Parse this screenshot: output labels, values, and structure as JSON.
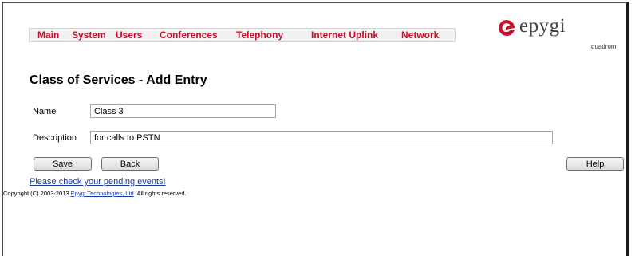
{
  "nav": {
    "items": [
      "Main",
      "System",
      "Users",
      "Conferences",
      "Telephony",
      "Internet Uplink",
      "Network"
    ]
  },
  "brand": {
    "name": "epygi",
    "subtitle": "quadrom",
    "color": "#c8102e"
  },
  "page": {
    "title": "Class of Services - Add Entry"
  },
  "form": {
    "name_label": "Name",
    "name_value": "Class 3",
    "description_label": "Description",
    "description_value": "for calls to PSTN"
  },
  "buttons": {
    "save": "Save",
    "back": "Back",
    "help": "Help"
  },
  "footer": {
    "pending_events_link": "Please check your pending events!",
    "copyright_prefix": "Copyright (C) 2003-2013 ",
    "company_link": "Epygi Technologies, Ltd",
    "copyright_suffix": ". All rights reserved."
  }
}
